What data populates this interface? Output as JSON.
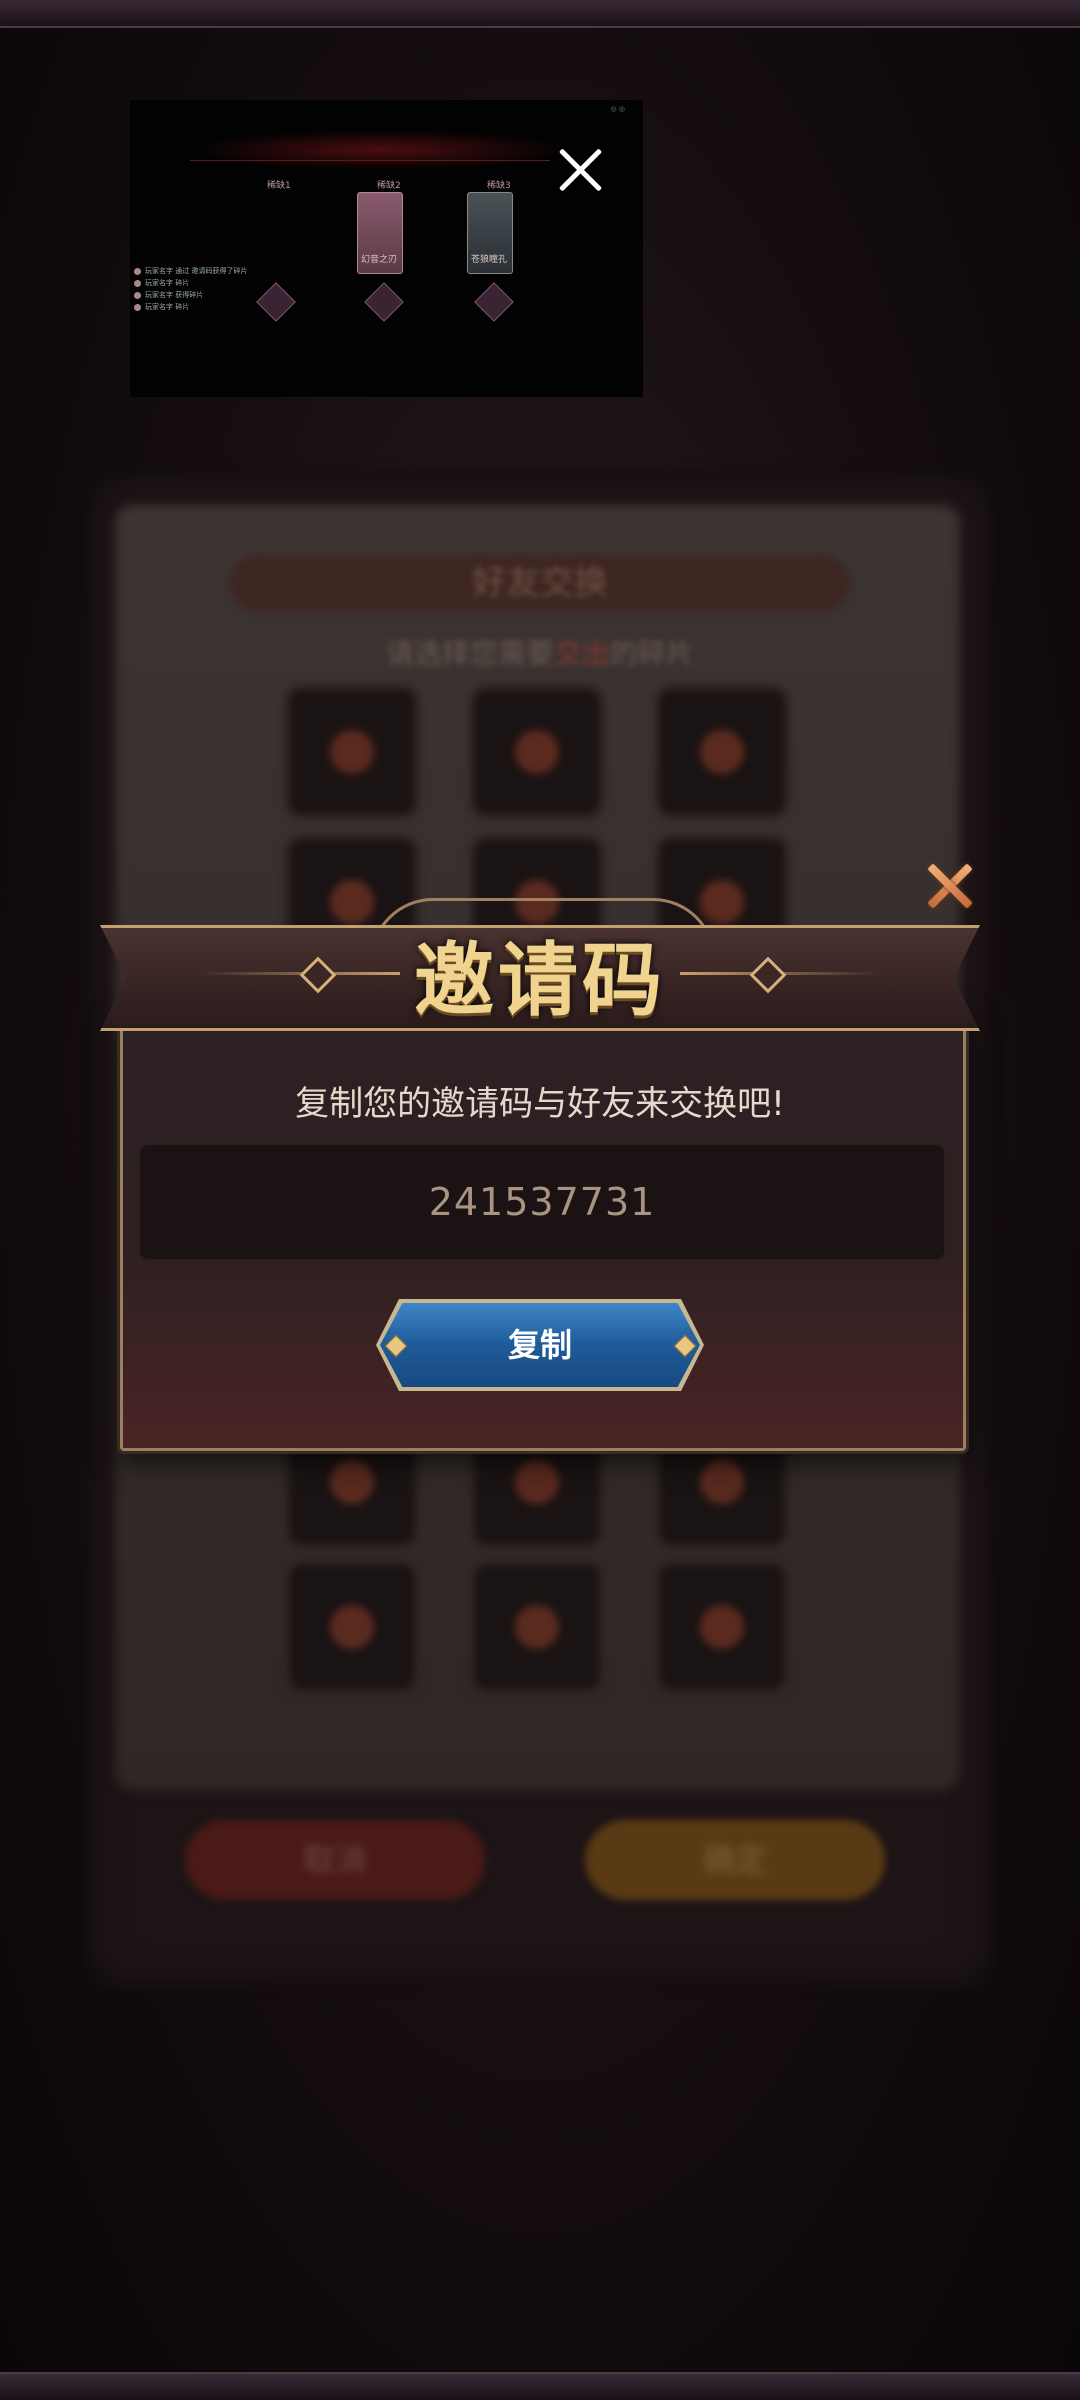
{
  "background": {
    "panel_title": "好友交换",
    "panel_subtitle_pre": "请选择您需要",
    "panel_subtitle_highlight": "交出",
    "panel_subtitle_post": "的碎片",
    "cancel_label": "取消",
    "confirm_label": "确定"
  },
  "preview": {
    "top_right_text": "◎ ◎",
    "labels": [
      "稀缺1",
      "稀缺2",
      "稀缺3"
    ],
    "card_captions": [
      "幻音之刃",
      "苍狼瞳孔"
    ],
    "log_lines": [
      "玩家名字 通过 邀请码获得了碎片",
      "玩家名字 碎片",
      "玩家名字 获得碎片",
      "玩家名字 碎片"
    ]
  },
  "dialog": {
    "title": "邀请码",
    "message": "复制您的邀请码与好友来交换吧!",
    "invite_code": "241537731",
    "copy_button": "复制"
  },
  "colors": {
    "title_gold": "#f0d38e",
    "button_blue": "#1f5a98",
    "close_orange": "#e09060"
  }
}
